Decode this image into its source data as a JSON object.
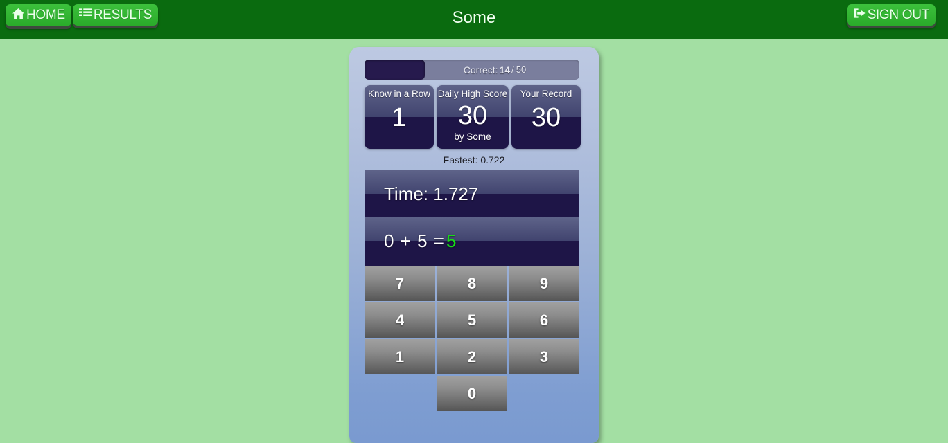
{
  "navbar": {
    "brand_title": "Some",
    "home_label": "HOME",
    "home_icon": "home-icon",
    "results_label": "RESULTS",
    "results_icon": "list-icon",
    "signout_label": "SIGN OUT",
    "signout_icon": "sign-out-icon",
    "bar_color": "#0a6b0f",
    "button_color": "#2aab2a"
  },
  "page": {
    "background_color": "#a3dfa3"
  },
  "progress": {
    "label_prefix": "Correct:",
    "correct": "14",
    "separator": "/",
    "total": "50",
    "percent": 28,
    "fill_color": "#261a4d",
    "track_color": "#7a7e9d"
  },
  "scores": [
    {
      "title": "Know in a Row",
      "value": "1",
      "sub": ""
    },
    {
      "title": "Daily High Score",
      "value": "30",
      "sub": "by Some"
    },
    {
      "title": "Your Record",
      "value": "30",
      "sub": ""
    }
  ],
  "fastest": {
    "label": "Fastest: 0.722"
  },
  "timer": {
    "label": "Time: 1.727"
  },
  "equation": {
    "left_operand": "0",
    "operator": "+",
    "right_operand": "5",
    "equals": "=",
    "answer": "5",
    "answer_color": "#16dd16",
    "full_text": "0 + 5 ="
  },
  "keypad": {
    "keys": [
      "7",
      "8",
      "9",
      "4",
      "5",
      "6",
      "1",
      "2",
      "3"
    ],
    "zero_key": "0"
  }
}
